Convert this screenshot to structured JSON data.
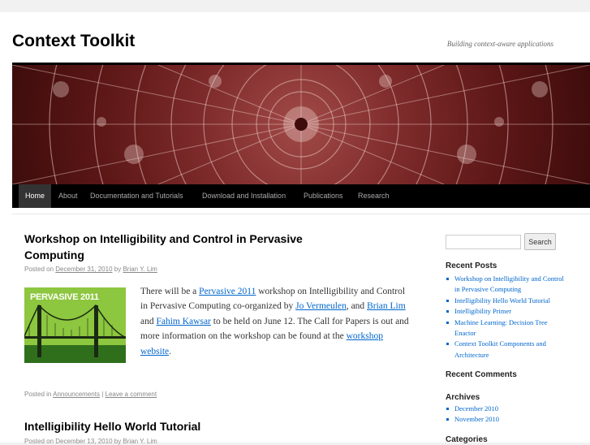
{
  "site": {
    "title": "Context Toolkit",
    "tagline": "Building context-aware applications"
  },
  "nav": [
    {
      "label": "Home",
      "current": true
    },
    {
      "label": "About"
    },
    {
      "label": "Documentation and Tutorials"
    },
    {
      "label": "Download and Installation"
    },
    {
      "label": "Publications"
    },
    {
      "label": "Research"
    }
  ],
  "post1": {
    "title": "Workshop on Intelligibility and Control in Pervasive Computing",
    "posted_on": "Posted on",
    "date": "December 31, 2010",
    "by": "by",
    "author": "Brian Y. Lim",
    "thumb_label": "PERVASIVE 2011",
    "text": {
      "t1": "There will be a ",
      "l1": "Pervasive 2011",
      "t2": " workshop on Intelligibility and Control in Pervasive Computing co-organized by ",
      "l2": "Jo Vermeulen",
      "t3": ", and ",
      "l3": "Brian Lim",
      "t4": " and ",
      "l4": "Fahim Kawsar",
      "t5": " to be held on June 12. The Call for Papers is out and more information on the workshop can be found at the ",
      "l5": "workshop website",
      "t6": "."
    },
    "posted_in": "Posted in",
    "category": "Announcements",
    "sep": "|",
    "comment": "Leave a comment"
  },
  "post2": {
    "title": "Intelligibility Hello World Tutorial",
    "meta": "Posted on December 13, 2010 by Brian Y. Lim"
  },
  "sidebar": {
    "search_placeholder": "",
    "search_button": "Search",
    "recent_posts_title": "Recent Posts",
    "recent_posts": [
      "Workshop on Intelligibility and Control in Pervasive Computing",
      "Intelligibility Hello World Tutorial",
      "Intelligibility Primer",
      "Machine Learning: Decision Tree Enactor",
      "Context Toolkit Components and Architecture"
    ],
    "recent_comments_title": "Recent Comments",
    "archives_title": "Archives",
    "archives": [
      "December 2010",
      "November 2010"
    ],
    "categories_title": "Categories"
  },
  "colors": {
    "link": "#0066cc",
    "nav_bg": "#000000",
    "thumb_bg": "#8dc63f",
    "banner": "#7d2a2a"
  }
}
